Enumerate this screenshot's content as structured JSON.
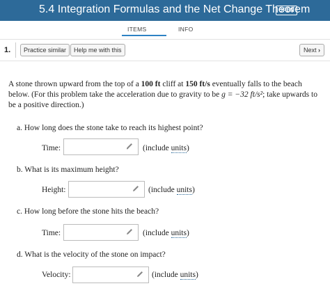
{
  "header": {
    "title": "5.4 Integration Formulas and the Net Change Theorem",
    "badge": "OPEN"
  },
  "tabs": {
    "items": "ITEMS",
    "info": "INFO"
  },
  "navbar": {
    "number": "1.",
    "similar": "Practice similar",
    "help": "Help me with this",
    "next": "Next"
  },
  "problem": {
    "p1": "A stone thrown upward from the top of a ",
    "cliff": "100 ft",
    "p2": " cliff at ",
    "vel": "150 ft/s",
    "p3": " eventually falls to the beach below. (For this problem take the acceleration due to gravity to be ",
    "g": "g = −32 ft/s²",
    "p4": "; take upwards to be a positive direction.)"
  },
  "questions": {
    "a": {
      "text": "a. How long does the stone take to reach its highest point?",
      "label": "Time:",
      "value": ""
    },
    "b": {
      "text": "b. What is its maximum height?",
      "label": "Height:",
      "value": ""
    },
    "c": {
      "text": "c. How long before the stone hits the beach?",
      "label": "Time:",
      "value": ""
    },
    "d": {
      "text": "d. What is the velocity of the stone on impact?",
      "label": "Velocity:",
      "value": ""
    }
  },
  "include_prefix": "(include ",
  "include_units": "units",
  "include_suffix": ")"
}
